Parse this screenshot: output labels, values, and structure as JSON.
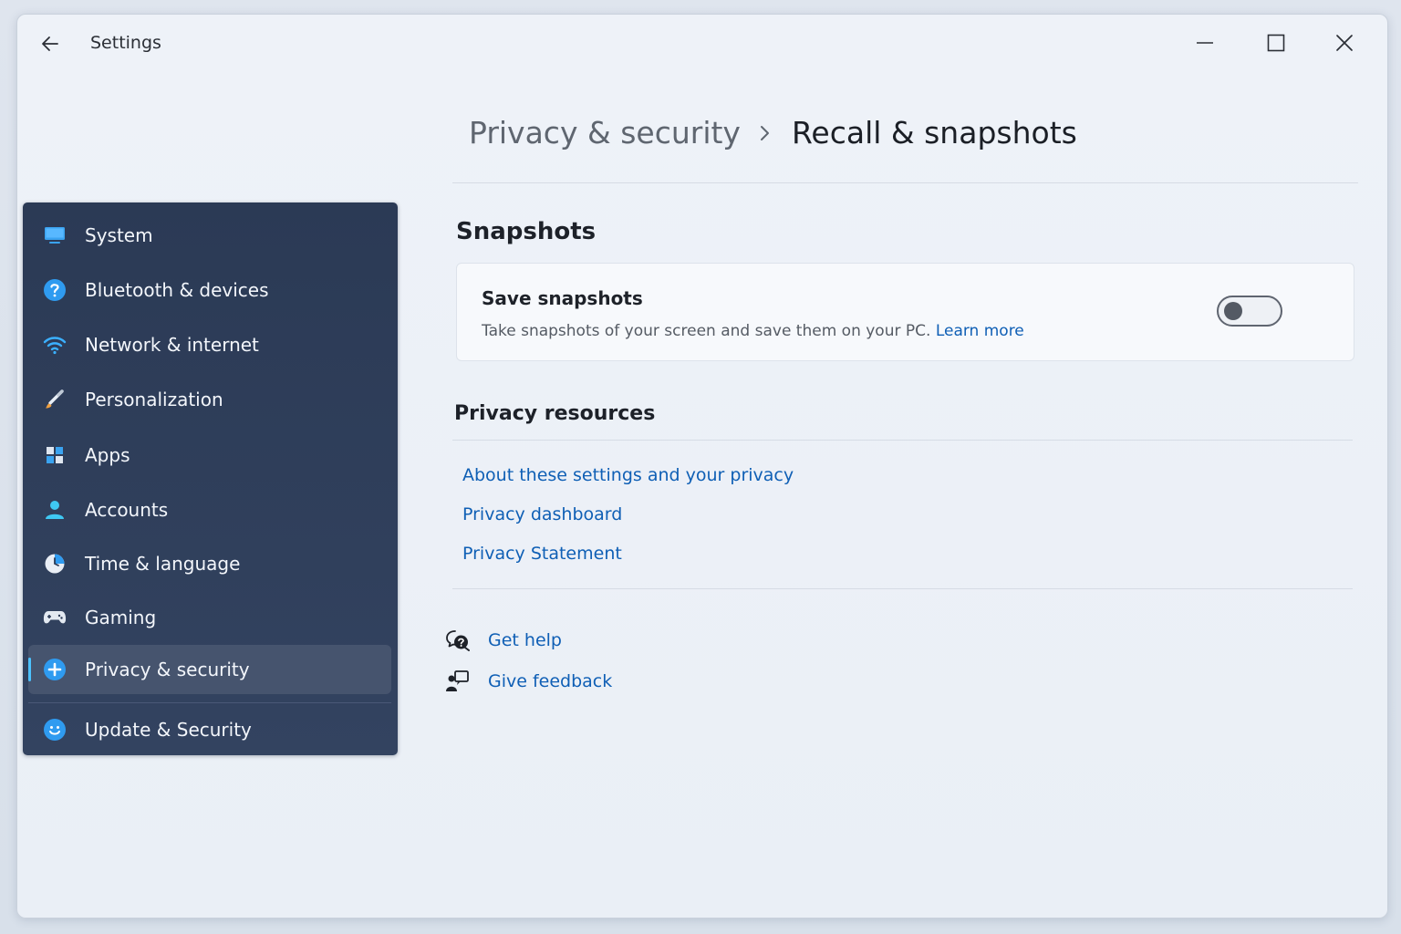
{
  "window": {
    "title": "Settings"
  },
  "breadcrumb": {
    "parent": "Privacy & security",
    "current": "Recall & snapshots"
  },
  "sidebar": {
    "items": [
      {
        "label": "System",
        "icon": "monitor-icon"
      },
      {
        "label": "Bluetooth & devices",
        "icon": "bluetooth-icon"
      },
      {
        "label": "Network & internet",
        "icon": "wifi-icon"
      },
      {
        "label": "Personalization",
        "icon": "brush-icon"
      },
      {
        "label": "Apps",
        "icon": "apps-icon"
      },
      {
        "label": "Accounts",
        "icon": "person-icon"
      },
      {
        "label": "Time & language",
        "icon": "clock-globe-icon"
      },
      {
        "label": "Gaming",
        "icon": "gamepad-icon"
      },
      {
        "label": "Privacy & security",
        "icon": "shield-icon",
        "selected": true
      },
      {
        "label": "Update & Security",
        "icon": "update-icon"
      }
    ]
  },
  "snapshots": {
    "heading": "Snapshots",
    "save_title": "Save snapshots",
    "save_desc": "Take snapshots of your screen and save them on your PC.",
    "learn_more": "Learn more",
    "toggle_on": false
  },
  "privacy_resources": {
    "heading": "Privacy resources",
    "links": [
      "About these settings and your privacy",
      "Privacy dashboard",
      "Privacy Statement"
    ]
  },
  "help": {
    "get_help": "Get help",
    "give_feedback": "Give feedback"
  },
  "colors": {
    "accent": "#4cc2ff",
    "link": "#0f5fb5",
    "sidebar_bg": "#2b3a55",
    "sidebar_selected": "#46546e"
  }
}
